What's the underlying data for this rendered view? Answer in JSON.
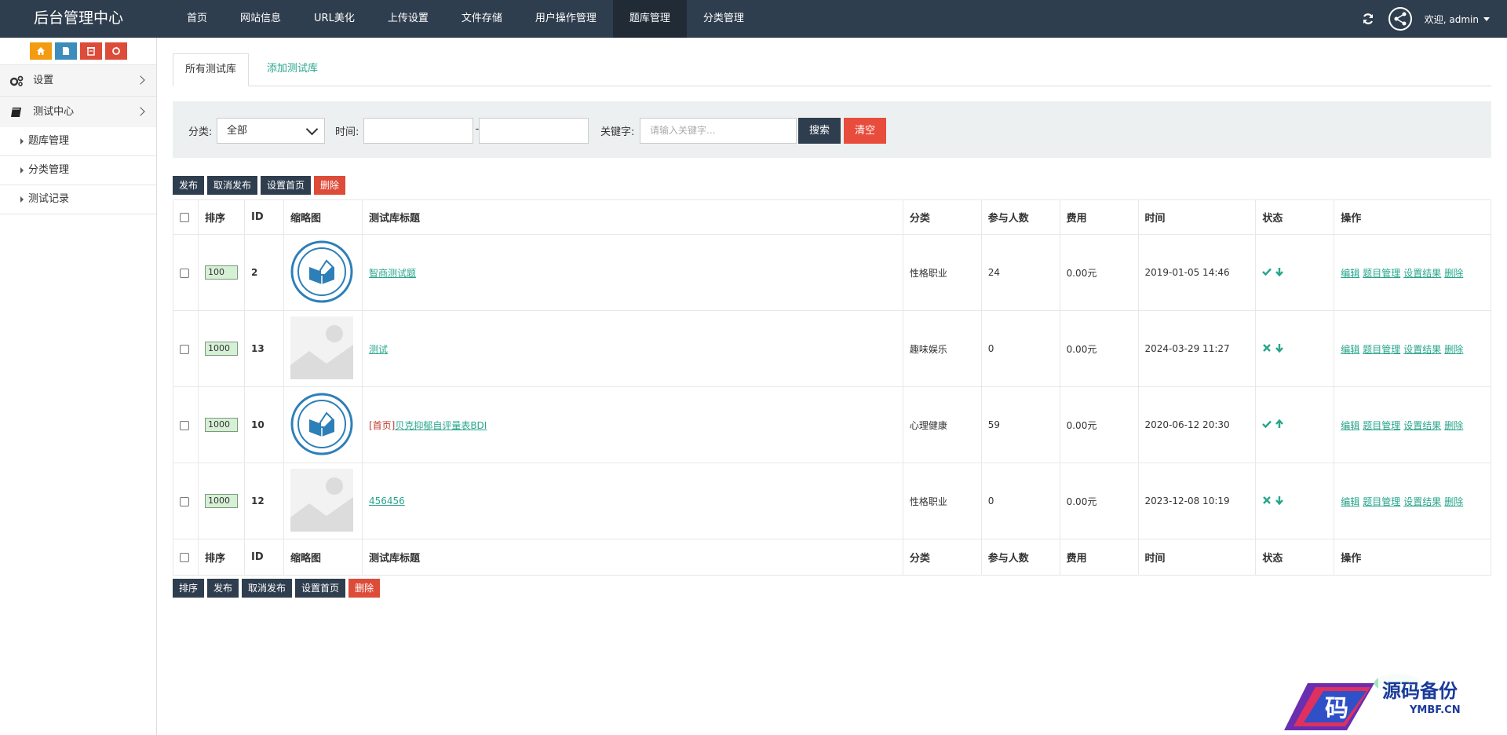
{
  "brand": "后台管理中心",
  "nav": [
    "首页",
    "网站信息",
    "URL美化",
    "上传设置",
    "文件存储",
    "用户操作管理",
    "题库管理",
    "分类管理"
  ],
  "nav_active": 6,
  "user": {
    "welcome": "欢迎, admin"
  },
  "sidebar": {
    "groups": [
      {
        "label": "设置",
        "icon": "gears-icon"
      },
      {
        "label": "测试中心",
        "icon": "book-icon"
      }
    ],
    "items": [
      "题库管理",
      "分类管理",
      "测试记录"
    ]
  },
  "tabs": {
    "all": "所有测试库",
    "add": "添加测试库"
  },
  "filter": {
    "category_label": "分类:",
    "category_value": "全部",
    "time_label": "时间:",
    "dash": "-",
    "keyword_label": "关键字:",
    "keyword_placeholder": "请输入关键字...",
    "search": "搜索",
    "clear": "清空"
  },
  "top_buttons": {
    "publish": "发布",
    "unpublish": "取消发布",
    "set_home": "设置首页",
    "delete": "删除"
  },
  "bottom_buttons": {
    "sort": "排序",
    "publish": "发布",
    "unpublish": "取消发布",
    "set_home": "设置首页",
    "delete": "删除"
  },
  "columns": {
    "sort": "排序",
    "id": "ID",
    "thumb": "缩略图",
    "title": "测试库标题",
    "category": "分类",
    "participants": "参与人数",
    "fee": "费用",
    "time": "时间",
    "status": "状态",
    "ops": "操作"
  },
  "ops": {
    "edit": "编辑",
    "questions": "题目管理",
    "results": "设置结果",
    "delete": "删除"
  },
  "rows": [
    {
      "sort": "100",
      "id": "2",
      "thumb": "logo",
      "home_tag": "",
      "title": "智商测试题",
      "category": "性格职业",
      "participants": "24",
      "fee": "0.00元",
      "time": "2019-01-05 14:46",
      "status": "published",
      "direction": "down"
    },
    {
      "sort": "1000",
      "id": "13",
      "thumb": "placeholder",
      "home_tag": "",
      "title": "测试",
      "category": "趣味娱乐",
      "participants": "0",
      "fee": "0.00元",
      "time": "2024-03-29 11:27",
      "status": "unpublished",
      "direction": "down"
    },
    {
      "sort": "1000",
      "id": "10",
      "thumb": "logo",
      "home_tag": "[首页]",
      "title": "贝克抑郁自评量表BDI",
      "category": "心理健康",
      "participants": "59",
      "fee": "0.00元",
      "time": "2020-06-12 20:30",
      "status": "published",
      "direction": "up"
    },
    {
      "sort": "1000",
      "id": "12",
      "thumb": "placeholder",
      "home_tag": "",
      "title": "456456",
      "category": "性格职业",
      "participants": "0",
      "fee": "0.00元",
      "time": "2023-12-08 10:19",
      "status": "unpublished",
      "direction": "down"
    }
  ],
  "watermark": {
    "text": "源码备份",
    "site": "YMBF.CN",
    "glyph": "码"
  },
  "colors": {
    "topbar": "#2f3e4e",
    "accent": "#27a58d",
    "danger": "#dd4b39"
  }
}
